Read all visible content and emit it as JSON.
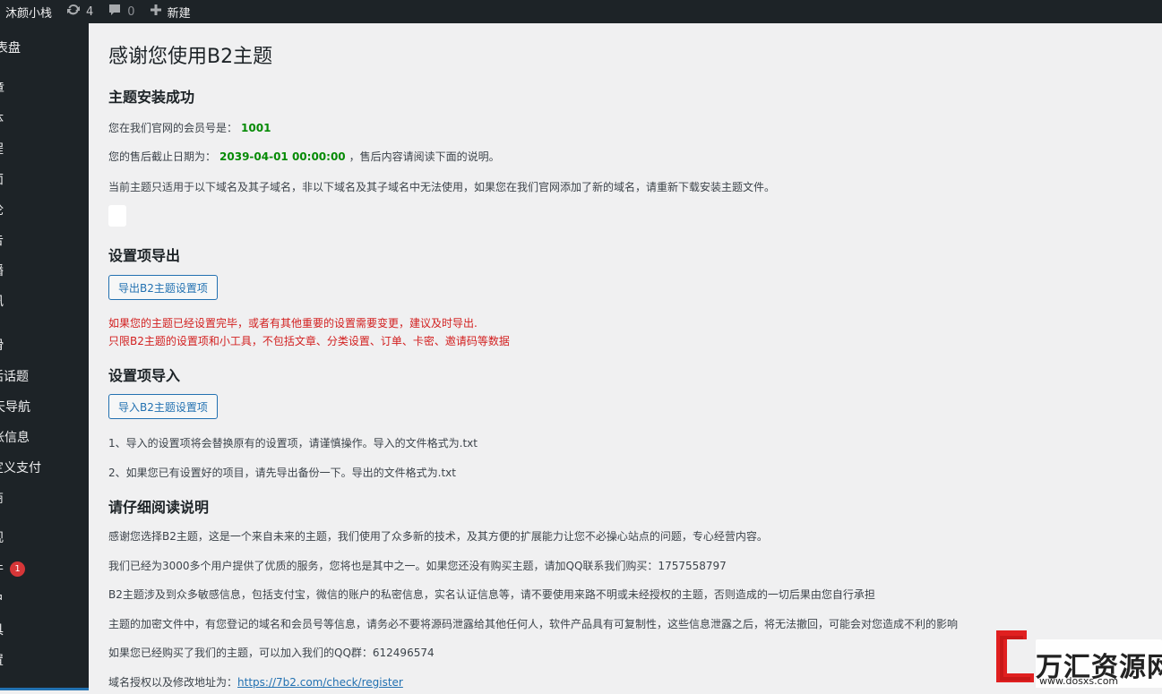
{
  "adminbar": {
    "site_name": "沐颜小栈",
    "updates_count": "4",
    "comments_count": "0",
    "new_label": "新建"
  },
  "sidebar": {
    "items": [
      "表盘",
      "章",
      "体",
      "程",
      "面",
      "论",
      "告",
      "播",
      "讯",
      "滑",
      "活话题",
      "天导航",
      "帐信息",
      "定义支付",
      "商",
      "观",
      "件",
      "户",
      "具",
      "置"
    ],
    "plugins_badge": "1"
  },
  "main": {
    "page_title": "感谢您使用B2主题",
    "install": {
      "heading": "主题安装成功",
      "member_prefix": "您在我们官网的会员号是：",
      "member_id": "1001",
      "expire_prefix": "您的售后截止日期为：",
      "expire_date": "2039-04-01 00:00:00",
      "expire_suffix": "，售后内容请阅读下面的说明。",
      "domain_note": "当前主题只适用于以下域名及其子域名，非以下域名及其子域名中无法使用，如果您在我们官网添加了新的域名，请重新下载安装主题文件。"
    },
    "export": {
      "heading": "设置项导出",
      "button_label": "导出B2主题设置项",
      "warning_1": "如果您的主题已经设置完毕，或者有其他重要的设置需要变更，建议及时导出.",
      "warning_2": "只限B2主题的设置项和小工具，不包括文章、分类设置、订单、卡密、邀请码等数据"
    },
    "import": {
      "heading": "设置项导入",
      "button_label": "导入B2主题设置项",
      "note_1": "1、导入的设置项将会替换原有的设置项，请谨慎操作。导入的文件格式为.txt",
      "note_2": "2、如果您已有设置好的项目，请先导出备份一下。导出的文件格式为.txt"
    },
    "readme": {
      "heading": "请仔细阅读说明",
      "p1": "感谢您选择B2主题，这是一个来自未来的主题，我们使用了众多新的技术，及其方便的扩展能力让您不必操心站点的问题，专心经营内容。",
      "p2": "我们已经为3000多个用户提供了优质的服务，您将也是其中之一。如果您还没有购买主题，请加QQ联系我们购买：1757558797",
      "p3": "B2主题涉及到众多敏感信息，包括支付宝，微信的账户的私密信息，实名认证信息等，请不要使用来路不明或未经授权的主题，否则造成的一切后果由您自行承担",
      "p4": "主题的加密文件中，有您登记的域名和会员号等信息，请务必不要将源码泄露给其他任何人，软件产品具有可复制性，这些信息泄露之后，将无法撤回，可能会对您造成不利的影响",
      "p5": "如果您已经购买了我们的主题，可以加入我们的QQ群：612496574",
      "p6_prefix": "域名授权以及修改地址为：",
      "p6_link": "https://7b2.com/check/register"
    }
  },
  "watermark": {
    "title": "万汇资源网",
    "url": "www.dosxs.com"
  },
  "colors": {
    "admin_bg": "#1d2327",
    "accent": "#2271b1",
    "highlight_green": "#068b06",
    "warning_red": "#d21f1f",
    "badge_red": "#d63638"
  }
}
